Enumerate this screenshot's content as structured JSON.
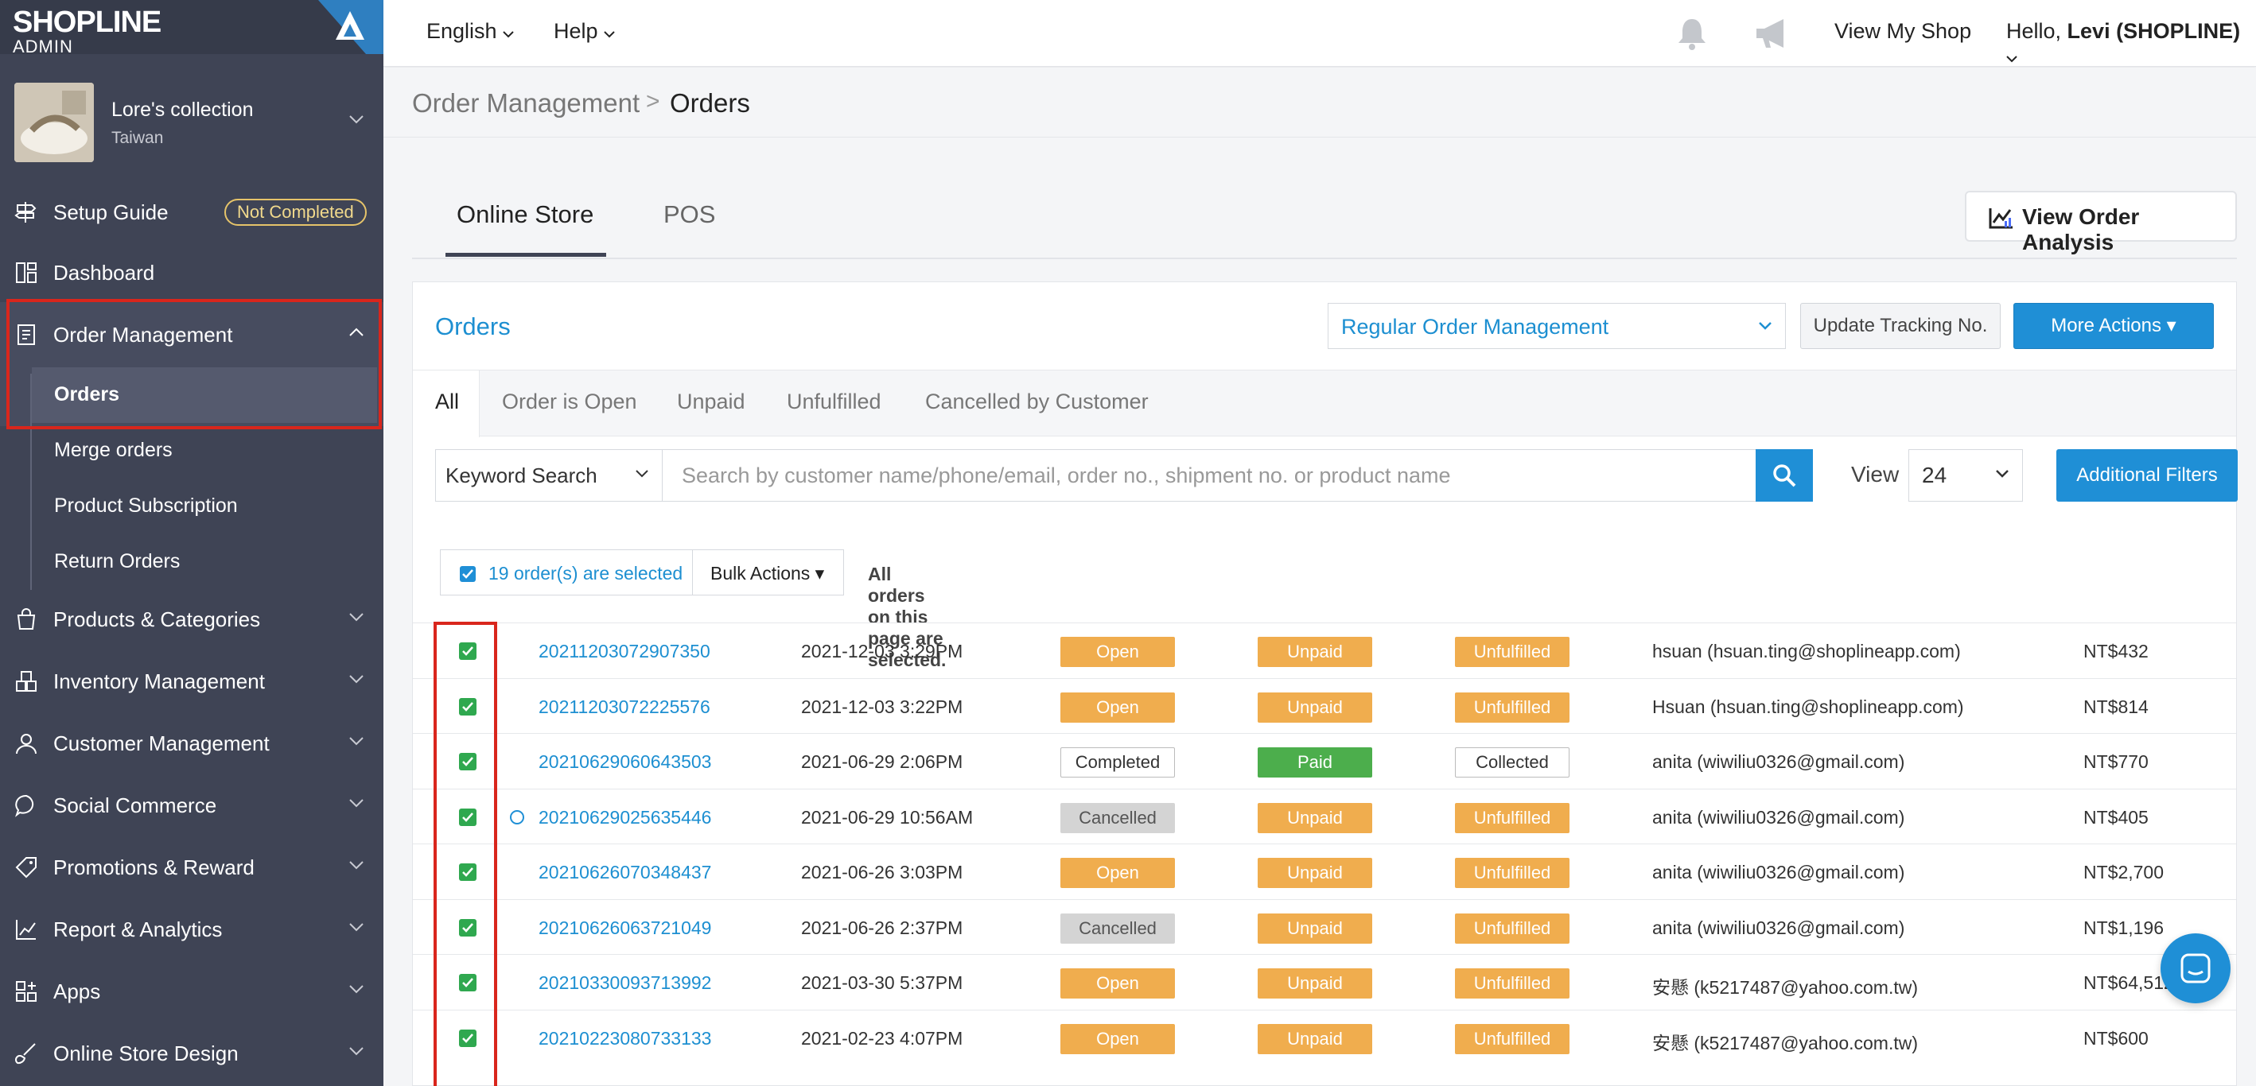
{
  "brand": {
    "logo_main": "SHOPLINE",
    "logo_sub": "ADMIN"
  },
  "store": {
    "name": "Lore's collection",
    "region": "Taiwan"
  },
  "sidebar": {
    "setup": {
      "label": "Setup Guide",
      "badge": "Not Completed"
    },
    "dashboard": "Dashboard",
    "order_management": "Order Management",
    "order_sub": [
      "Orders",
      "Merge orders",
      "Product Subscription",
      "Return Orders"
    ],
    "items": [
      "Products & Categories",
      "Inventory Management",
      "Customer Management",
      "Social Commerce",
      "Promotions & Reward",
      "Report & Analytics",
      "Apps",
      "Online Store Design"
    ]
  },
  "topbar": {
    "language": "English",
    "help": "Help",
    "view_shop": "View My Shop",
    "greeting_prefix": "Hello,",
    "user": "Levi (SHOPLINE)"
  },
  "breadcrumb": {
    "parent": "Order Management",
    "separator": ">",
    "current": "Orders"
  },
  "tabs": {
    "online": "Online Store",
    "pos": "POS"
  },
  "analysis_button": "View Order Analysis",
  "card": {
    "title": "Orders",
    "management_select": "Regular Order Management",
    "tracking_button": "Update Tracking No.",
    "more_actions": "More Actions ▾",
    "filter_tabs": [
      "All",
      "Order is Open",
      "Unpaid",
      "Unfulfilled",
      "Cancelled by Customer"
    ],
    "keyword_select": "Keyword Search",
    "search_placeholder": "Search by customer name/phone/email, order no., shipment no. or product name",
    "view_label": "View",
    "view_value": "24",
    "filters_button": "Additional Filters",
    "selected_text": "19 order(s) are selected",
    "bulk_actions": "Bulk Actions ▾",
    "all_selected": "All orders on this page are selected."
  },
  "orders": [
    {
      "no": "20211203072907350",
      "date": "2021-12-03 3:29PM",
      "status": "Open",
      "payment": "Unpaid",
      "fulfillment": "Unfulfilled",
      "customer": "hsuan (hsuan.ting@shoplineapp.com)",
      "amount": "NT$432"
    },
    {
      "no": "20211203072225576",
      "date": "2021-12-03 3:22PM",
      "status": "Open",
      "payment": "Unpaid",
      "fulfillment": "Unfulfilled",
      "customer": "Hsuan (hsuan.ting@shoplineapp.com)",
      "amount": "NT$814"
    },
    {
      "no": "20210629060643503",
      "date": "2021-06-29 2:06PM",
      "status": "Completed",
      "payment": "Paid",
      "fulfillment": "Collected",
      "customer": "anita (wiwiliu0326@gmail.com)",
      "amount": "NT$770"
    },
    {
      "no": "20210629025635446",
      "date": "2021-06-29 10:56AM",
      "status": "Cancelled",
      "payment": "Unpaid",
      "fulfillment": "Unfulfilled",
      "customer": "anita (wiwiliu0326@gmail.com)",
      "amount": "NT$405"
    },
    {
      "no": "20210626070348437",
      "date": "2021-06-26 3:03PM",
      "status": "Open",
      "payment": "Unpaid",
      "fulfillment": "Unfulfilled",
      "customer": "anita (wiwiliu0326@gmail.com)",
      "amount": "NT$2,700"
    },
    {
      "no": "20210626063721049",
      "date": "2021-06-26 2:37PM",
      "status": "Cancelled",
      "payment": "Unpaid",
      "fulfillment": "Unfulfilled",
      "customer": "anita (wiwiliu0326@gmail.com)",
      "amount": "NT$1,196"
    },
    {
      "no": "20210330093713992",
      "date": "2021-03-30 5:37PM",
      "status": "Open",
      "payment": "Unpaid",
      "fulfillment": "Unfulfilled",
      "customer": "安懸 (k5217487@yahoo.com.tw)",
      "amount": "NT$64,512"
    },
    {
      "no": "20210223080733133",
      "date": "2021-02-23 4:07PM",
      "status": "Open",
      "payment": "Unpaid",
      "fulfillment": "Unfulfilled",
      "customer": "安懸 (k5217487@yahoo.com.tw)",
      "amount": "NT$600"
    }
  ],
  "colors": {
    "sidebar": "#3f4455",
    "accent": "#1f8fd6",
    "highlight": "#d9261c",
    "warning": "#f0ad4e",
    "success": "#4cae4c"
  }
}
